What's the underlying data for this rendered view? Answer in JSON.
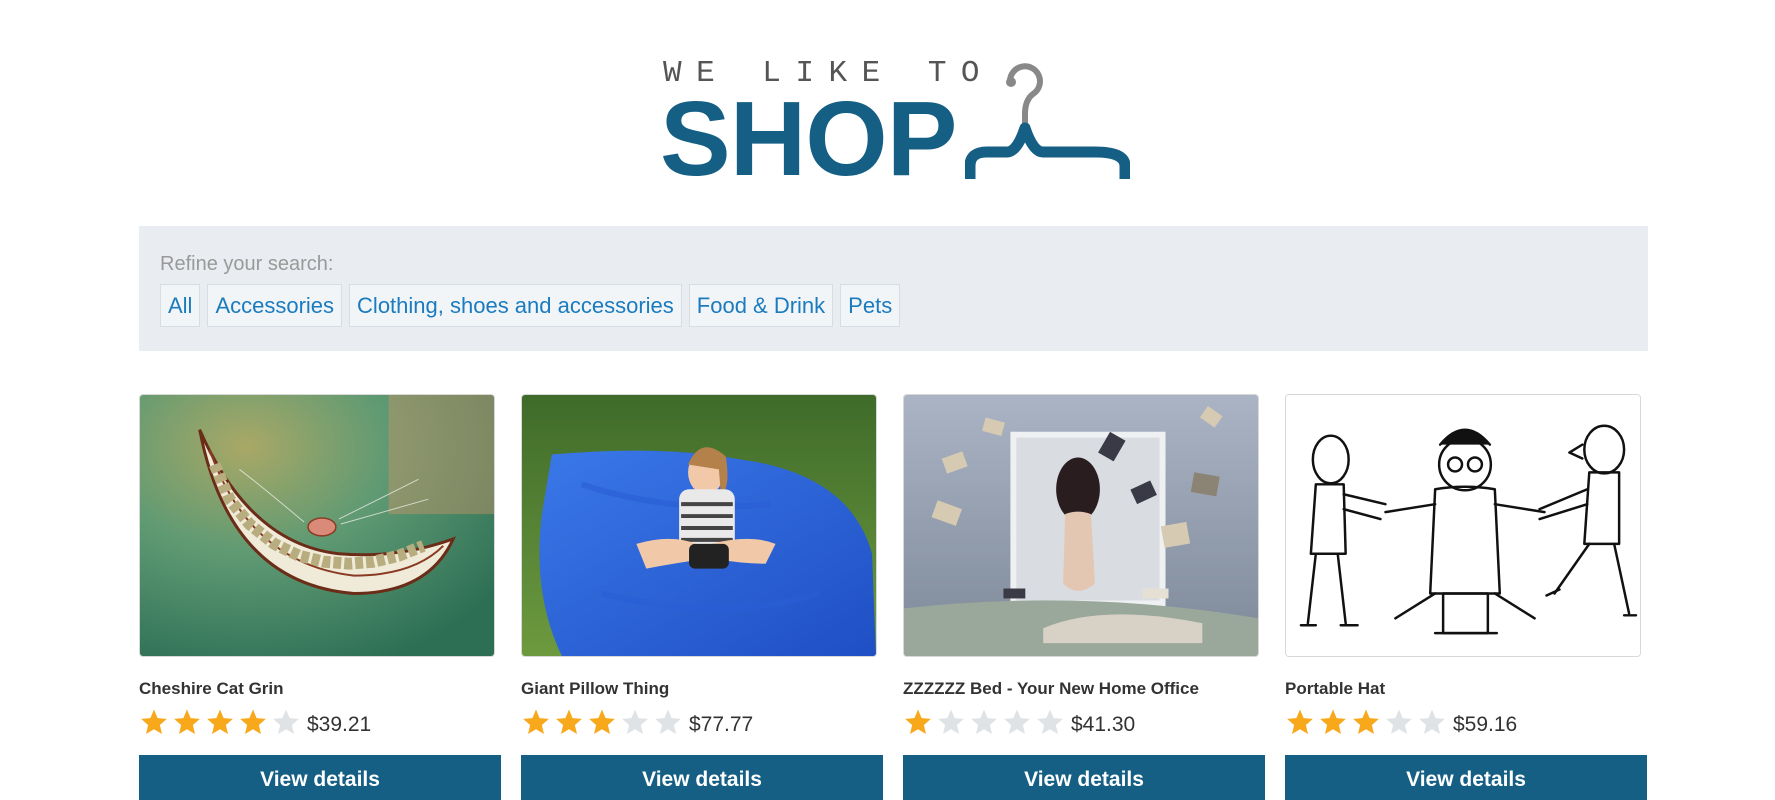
{
  "logo": {
    "line1": "WE LIKE TO",
    "line2": "SHOP",
    "icon": "hanger-icon",
    "colors": {
      "primary": "#155f85",
      "secondary": "#555555"
    }
  },
  "filters": {
    "label": "Refine your search:",
    "items": [
      "All",
      "Accessories",
      "Clothing, shoes and accessories",
      "Food & Drink",
      "Pets"
    ]
  },
  "products": [
    {
      "name": "Cheshire Cat Grin",
      "rating": 4,
      "max_rating": 5,
      "price": "$39.21",
      "button": "View details",
      "image": "cheshire-cat-grin-image"
    },
    {
      "name": "Giant Pillow Thing",
      "rating": 3,
      "max_rating": 5,
      "price": "$77.77",
      "button": "View details",
      "image": "giant-pillow-image"
    },
    {
      "name": "ZZZZZZ Bed - Your New Home Office",
      "rating": 1,
      "max_rating": 5,
      "price": "$41.30",
      "button": "View details",
      "image": "bed-floating-books-image"
    },
    {
      "name": "Portable Hat",
      "rating": 3,
      "max_rating": 5,
      "price": "$59.16",
      "button": "View details",
      "image": "portable-hat-sketch-image"
    }
  ],
  "colors": {
    "accent": "#155f85",
    "link": "#1a7bbf",
    "star_filled": "#f7a81b",
    "star_empty": "#dfe3e6",
    "filter_bg": "#e9edf1"
  }
}
